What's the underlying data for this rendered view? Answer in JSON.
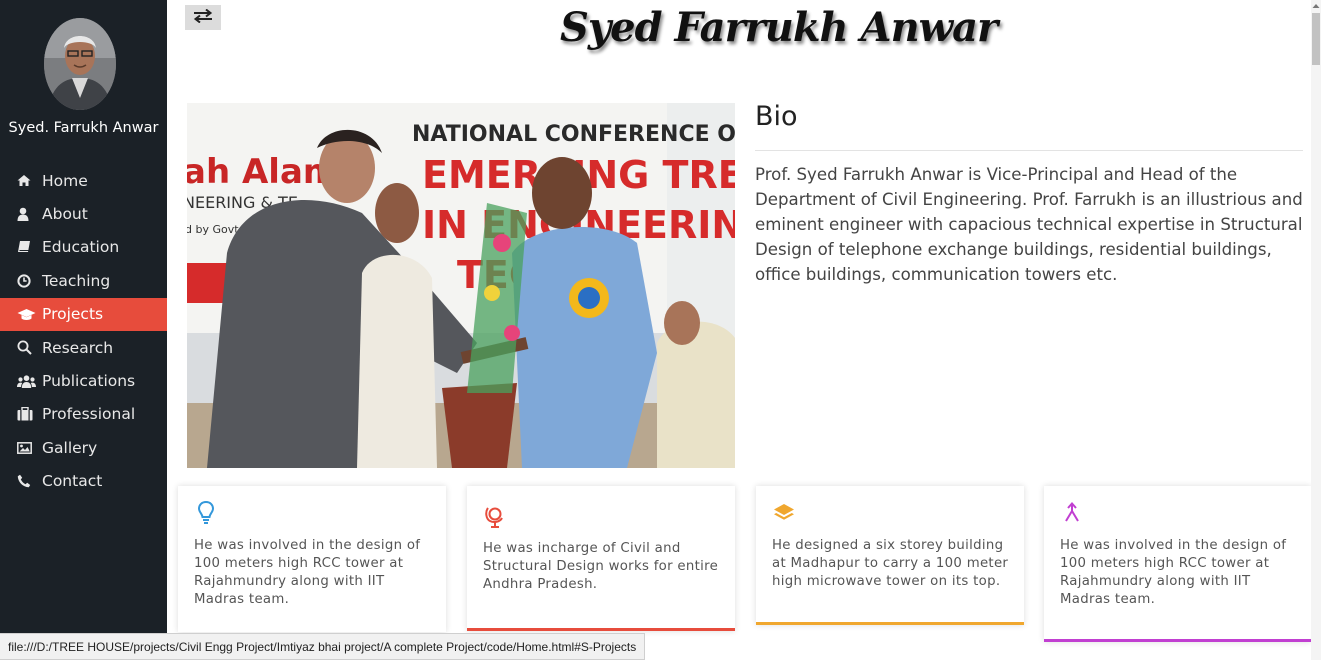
{
  "sidebar": {
    "name": "Syed. Farrukh Anwar",
    "items": [
      {
        "label": "Home",
        "icon": "home-icon",
        "active": false
      },
      {
        "label": "About",
        "icon": "user-icon",
        "active": false
      },
      {
        "label": "Education",
        "icon": "book-icon",
        "active": false
      },
      {
        "label": "Teaching",
        "icon": "clock-icon",
        "active": false
      },
      {
        "label": "Projects",
        "icon": "graduation-cap-icon",
        "active": true
      },
      {
        "label": "Research",
        "icon": "search-icon",
        "active": false
      },
      {
        "label": "Publications",
        "icon": "users-icon",
        "active": false
      },
      {
        "label": "Professional",
        "icon": "briefcase-icon",
        "active": false
      },
      {
        "label": "Gallery",
        "icon": "image-icon",
        "active": false
      },
      {
        "label": "Contact",
        "icon": "phone-icon",
        "active": false
      }
    ],
    "accent": "#e74c3c",
    "background": "#1b2127"
  },
  "header": {
    "signature": "Syed Farrukh Anwar"
  },
  "photo": {
    "banner_line1": "NATIONAL CONFERENCE O",
    "banner_line2": "EMERGING TRE",
    "banner_line3": "IN ENGINEERIN",
    "banner_line4": "TEC",
    "banner_left1": "ah Alam",
    "banner_left2": "NEERING & TE",
    "banner_left3": "d by Govt. of Telan"
  },
  "bio": {
    "title": "Bio",
    "text": " Prof. Syed Farrukh Anwar is Vice-Principal and Head of the Department of Civil Engineering. Prof. Farrukh is an illustrious and eminent engineer with capacious technical expertise in Structural Design of  telephone exchange buildings, residential buildings, office buildings, communication towers etc."
  },
  "cards": [
    {
      "text": "He was involved in the design of 100 meters high RCC tower at Rajahmundry along with IIT Madras team.",
      "icon": "lightbulb-icon",
      "color": "#3498db"
    },
    {
      "text": "He was incharge of Civil and Structural Design works for entire Andhra Pradesh.",
      "icon": "globe-stand-icon",
      "color": "#e74c3c"
    },
    {
      "text": "He designed a six storey building at Madhapur to carry a 100 meter high microwave tower on its top.",
      "icon": "layers-icon",
      "color": "#f0a72e"
    },
    {
      "text": "He was involved in the design of 100 meters high RCC tower at Rajahmundry along with IIT Madras team.",
      "icon": "merge-arrow-icon",
      "color": "#c13fd1"
    }
  ],
  "statusbar": {
    "url": "file:///D:/TREE HOUSE/projects/Civil Engg Project/Imtiyaz bhai project/A complete Project/code/Home.html#S-Projects"
  }
}
